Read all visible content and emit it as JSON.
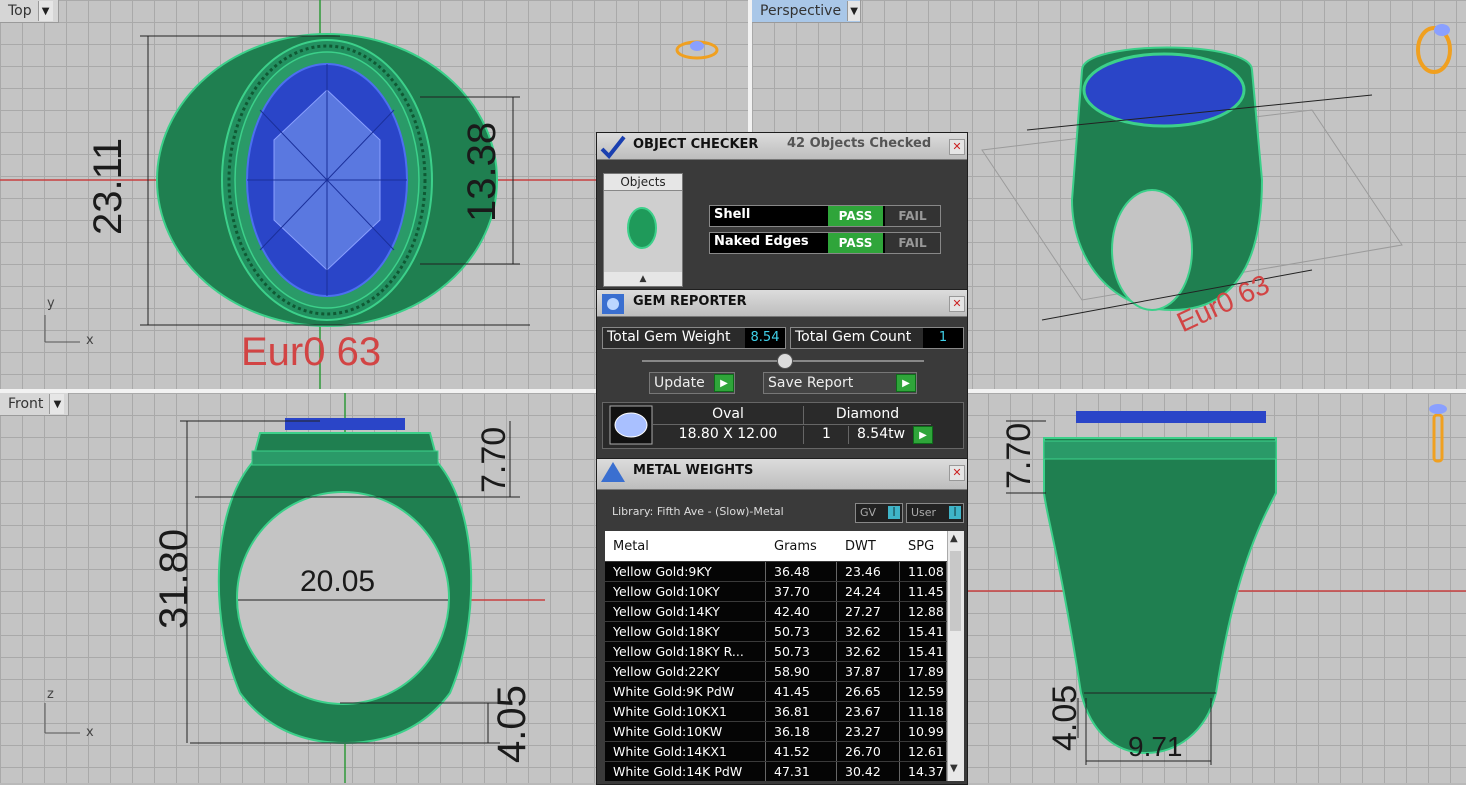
{
  "viewports": {
    "top": {
      "label": "Top",
      "axis_y": "y",
      "axis_x": "x",
      "dim_left": "23.11",
      "dim_right": "13.38",
      "size_label": "Eur0 63"
    },
    "perspective": {
      "label": "Perspective",
      "size_label": "Eur0 63"
    },
    "front": {
      "label": "Front",
      "axis_z": "z",
      "axis_x": "x",
      "dim_left": "31.80",
      "dim_top": "7.70",
      "dim_center": "20.05",
      "dim_bottom": "4.05"
    },
    "right": {
      "dim_top": "7.70",
      "dim_bottom": "4.05",
      "dim_width": "9.71"
    }
  },
  "object_checker": {
    "title": "OBJECT CHECKER",
    "subtitle": "42 Objects Checked",
    "objects_label": "Objects",
    "checks": [
      {
        "name": "Shell",
        "pass": "PASS",
        "fail": "FAIL"
      },
      {
        "name": "Naked Edges",
        "pass": "PASS",
        "fail": "FAIL"
      }
    ]
  },
  "gem_reporter": {
    "title": "GEM REPORTER",
    "total_weight_label": "Total Gem Weight",
    "total_weight": "8.54",
    "total_count_label": "Total Gem Count",
    "total_count": "1",
    "update_label": "Update",
    "save_label": "Save Report",
    "gem": {
      "shape": "Oval",
      "type": "Diamond",
      "size": "18.80 X 12.00",
      "count": "1",
      "weight": "8.54tw"
    }
  },
  "metal_weights": {
    "title": "METAL WEIGHTS",
    "library": "Library: Fifth Ave - (Slow)-Metal",
    "gv_label": "GV",
    "user_label": "User",
    "columns": [
      "Metal",
      "Grams",
      "DWT",
      "SPG"
    ],
    "rows": [
      [
        "Yellow Gold:9KY",
        "36.48",
        "23.46",
        "11.08"
      ],
      [
        "Yellow Gold:10KY",
        "37.70",
        "24.24",
        "11.45"
      ],
      [
        "Yellow Gold:14KY",
        "42.40",
        "27.27",
        "12.88"
      ],
      [
        "Yellow Gold:18KY",
        "50.73",
        "32.62",
        "15.41"
      ],
      [
        "Yellow Gold:18KY R...",
        "50.73",
        "32.62",
        "15.41"
      ],
      [
        "Yellow Gold:22KY",
        "58.90",
        "37.87",
        "17.89"
      ],
      [
        "White Gold:9K PdW",
        "41.45",
        "26.65",
        "12.59"
      ],
      [
        "White Gold:10KX1",
        "36.81",
        "23.67",
        "11.18"
      ],
      [
        "White Gold:10KW",
        "36.18",
        "23.27",
        "10.99"
      ],
      [
        "White Gold:14KX1",
        "41.52",
        "26.70",
        "12.61"
      ],
      [
        "White Gold:14K PdW",
        "47.31",
        "30.42",
        "14.37"
      ]
    ]
  },
  "colors": {
    "ring_green": "#1f8a55",
    "gem_blue": "#2a45c8",
    "size_label_red": "#d24444"
  }
}
